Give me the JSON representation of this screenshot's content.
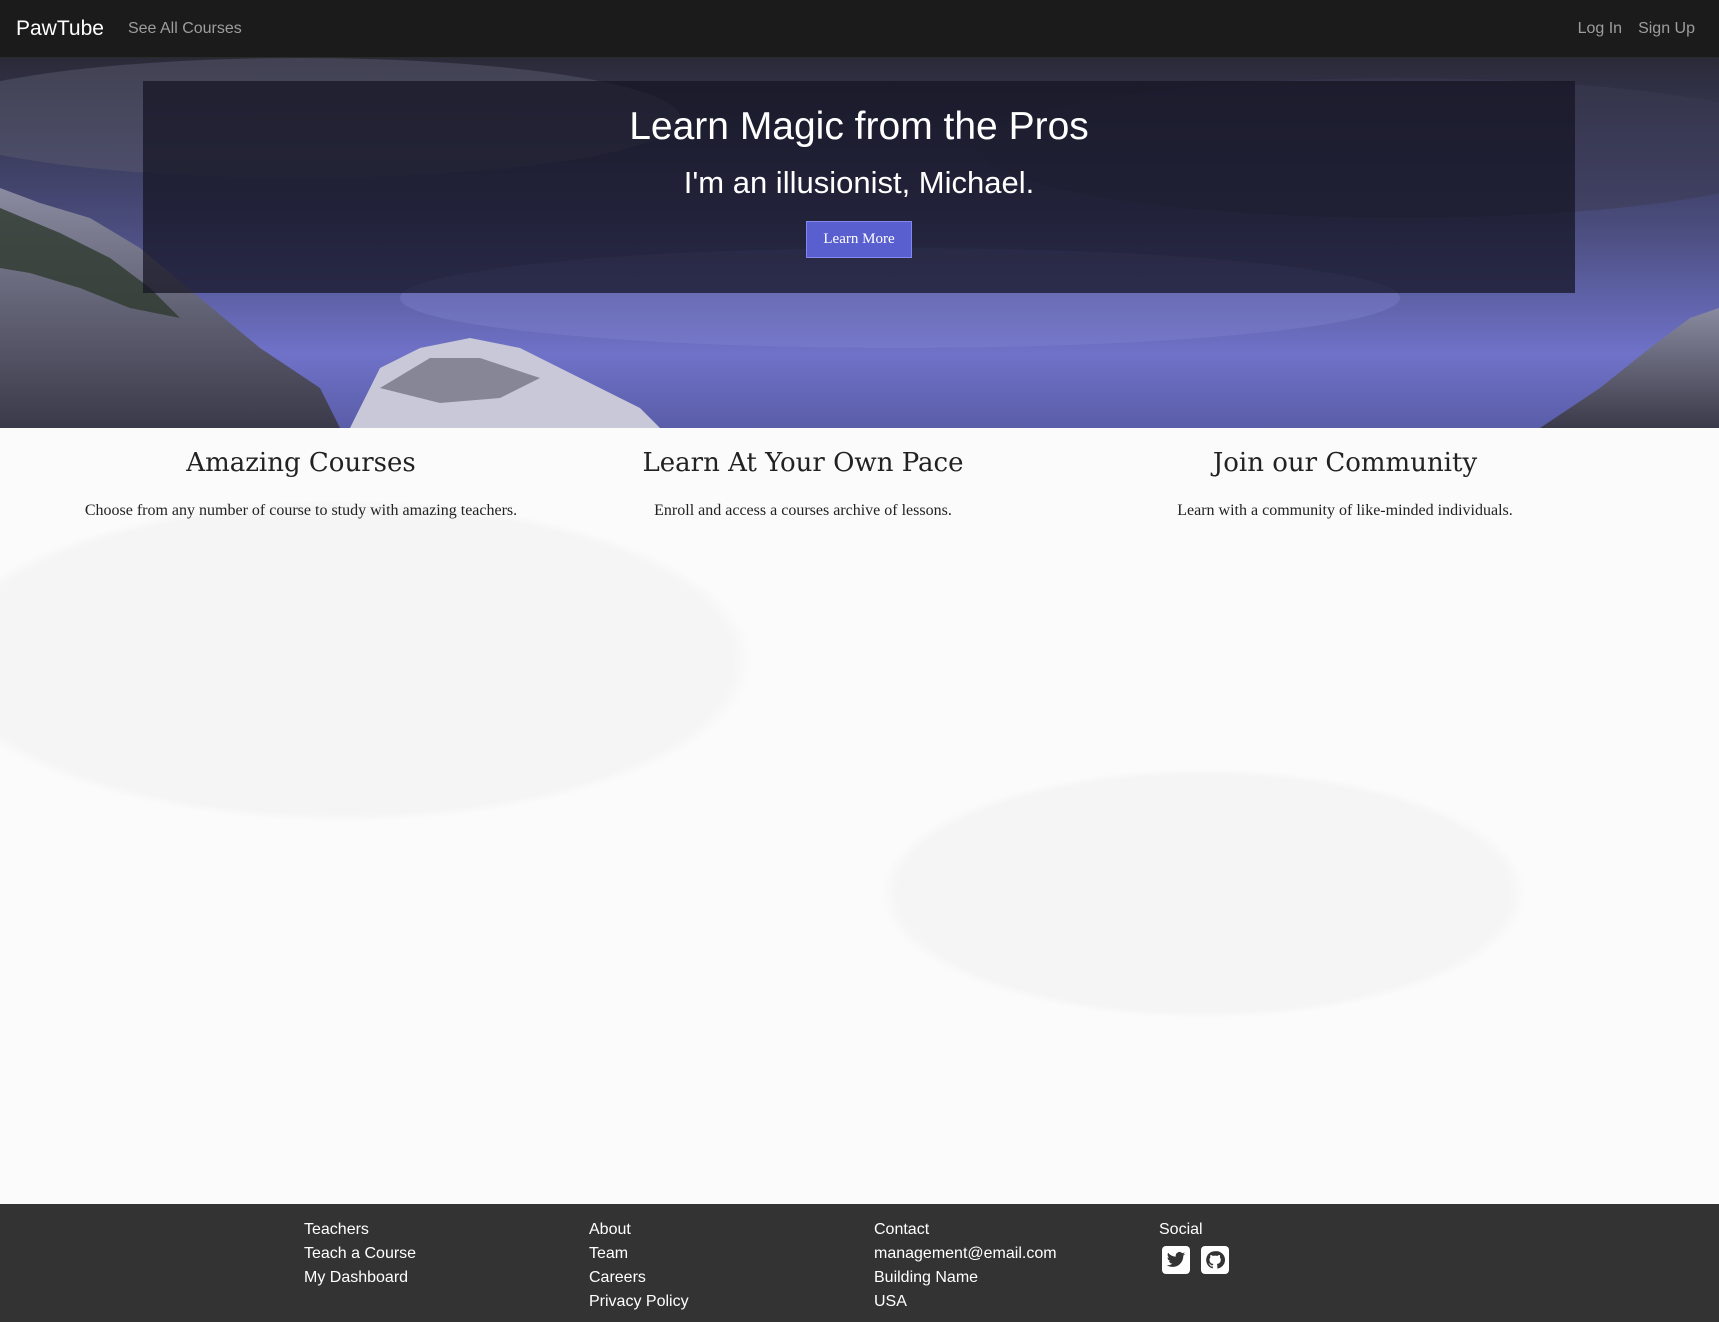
{
  "navbar": {
    "brand": "PawTube",
    "courses_link": "See All Courses",
    "login_link": "Log In",
    "signup_link": "Sign Up"
  },
  "hero": {
    "title": "Learn Magic from the Pros",
    "subtitle": "I'm an illusionist, Michael.",
    "cta_label": "Learn More"
  },
  "features": [
    {
      "title": "Amazing Courses",
      "text": "Choose from any number of course to study with amazing teachers."
    },
    {
      "title": "Learn At Your Own Pace",
      "text": "Enroll and access a courses archive of lessons."
    },
    {
      "title": "Join our Community",
      "text": "Learn with a community of like-minded individuals."
    }
  ],
  "footer": {
    "teachers": {
      "heading": "Teachers",
      "links": [
        "Teach a Course",
        "My Dashboard"
      ]
    },
    "about": {
      "heading": "About",
      "links": [
        "Team",
        "Careers",
        "Privacy Policy"
      ]
    },
    "contact": {
      "heading": "Contact",
      "lines": [
        "management@email.com",
        "Building Name",
        "USA"
      ]
    },
    "social": {
      "heading": "Social",
      "icons": [
        "twitter-icon",
        "github-icon"
      ]
    }
  },
  "colors": {
    "navbar_bg": "#1b1b1b",
    "hero_button": "#5a5fd0",
    "footer_bg": "#333333"
  }
}
